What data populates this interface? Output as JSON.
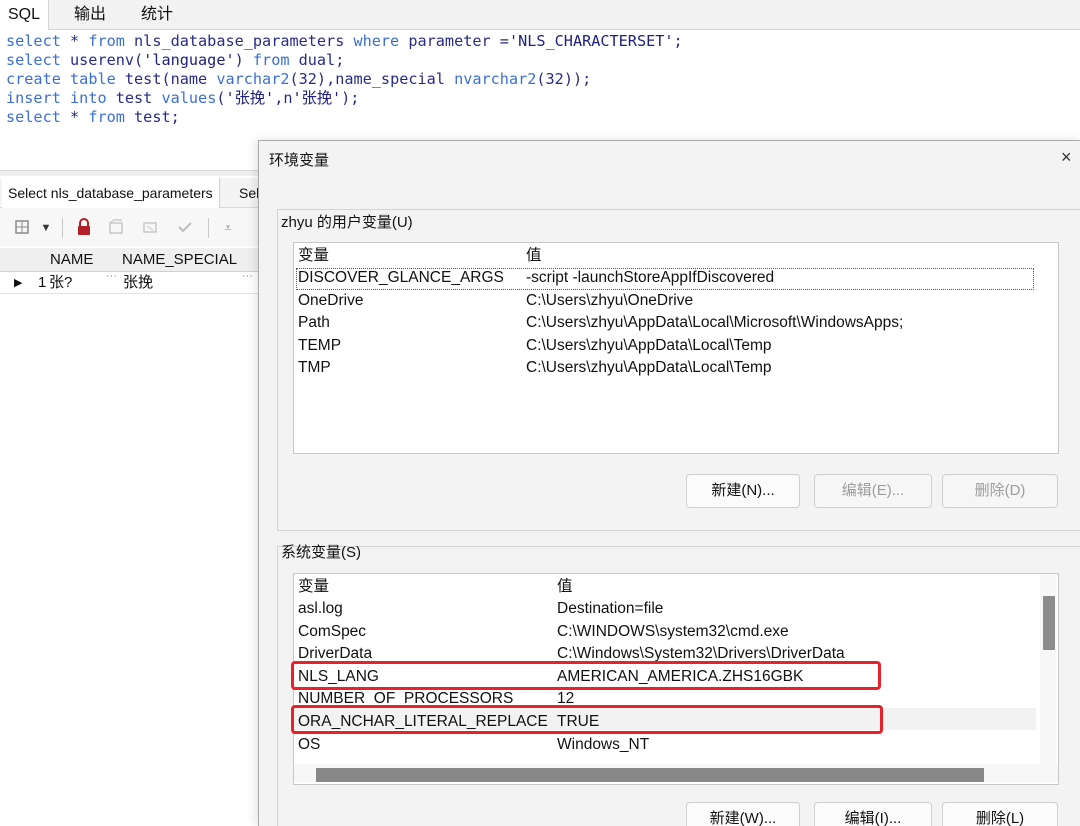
{
  "editor": {
    "tabs": [
      "SQL",
      "输出",
      "统计"
    ],
    "lines": [
      [
        {
          "t": "select",
          "c": "kw"
        },
        {
          "t": " * ",
          "c": "plain"
        },
        {
          "t": "from",
          "c": "kw"
        },
        {
          "t": " nls_database_parameters ",
          "c": "plain"
        },
        {
          "t": "where",
          "c": "kw"
        },
        {
          "t": " parameter =",
          "c": "plain"
        },
        {
          "t": "'NLS_CHARACTERSET'",
          "c": "str"
        },
        {
          "t": ";",
          "c": "plain"
        }
      ],
      [
        {
          "t": "select",
          "c": "kw"
        },
        {
          "t": " userenv(",
          "c": "plain"
        },
        {
          "t": "'language'",
          "c": "str"
        },
        {
          "t": ") ",
          "c": "plain"
        },
        {
          "t": "from",
          "c": "kw"
        },
        {
          "t": " dual;",
          "c": "plain"
        }
      ],
      [
        {
          "t": "create",
          "c": "kw"
        },
        {
          "t": " ",
          "c": "plain"
        },
        {
          "t": "table",
          "c": "kw"
        },
        {
          "t": " test(name ",
          "c": "plain"
        },
        {
          "t": "varchar2",
          "c": "kw"
        },
        {
          "t": "(32),name_special ",
          "c": "plain"
        },
        {
          "t": "nvarchar2",
          "c": "kw"
        },
        {
          "t": "(32));",
          "c": "plain"
        }
      ],
      [
        {
          "t": "insert",
          "c": "kw"
        },
        {
          "t": " ",
          "c": "plain"
        },
        {
          "t": "into",
          "c": "kw"
        },
        {
          "t": " test ",
          "c": "plain"
        },
        {
          "t": "values",
          "c": "kw"
        },
        {
          "t": "(",
          "c": "plain"
        },
        {
          "t": "'张挽'",
          "c": "str"
        },
        {
          "t": ",n",
          "c": "plain"
        },
        {
          "t": "'张挽'",
          "c": "str"
        },
        {
          "t": ");",
          "c": "plain"
        }
      ],
      [
        {
          "t": "select",
          "c": "kw"
        },
        {
          "t": " * ",
          "c": "plain"
        },
        {
          "t": "from",
          "c": "kw"
        },
        {
          "t": " test;",
          "c": "plain"
        }
      ]
    ]
  },
  "results": {
    "tabs": [
      "Select nls_database_parameters",
      "Sel"
    ],
    "toolbar_icons": [
      "query-grid-icon",
      "dropdown-arrow-icon",
      "lock-icon",
      "insert-record-icon",
      "delete-record-icon",
      "post-record-icon",
      "filter-icon"
    ],
    "columns": [
      "NAME",
      "NAME_SPECIAL"
    ],
    "row": {
      "num": "1",
      "name": "张?",
      "name_special": "张挽",
      "ellipsis": "···"
    }
  },
  "dialog": {
    "title": "环境变量",
    "close_glyph": "×",
    "user_group_label": "zhyu 的用户变量(U)",
    "user_headers": [
      "变量",
      "值"
    ],
    "user_vars": [
      [
        "DISCOVER_GLANCE_ARGS",
        "-script -launchStoreAppIfDiscovered"
      ],
      [
        "OneDrive",
        "C:\\Users\\zhyu\\OneDrive"
      ],
      [
        "Path",
        "C:\\Users\\zhyu\\AppData\\Local\\Microsoft\\WindowsApps;"
      ],
      [
        "TEMP",
        "C:\\Users\\zhyu\\AppData\\Local\\Temp"
      ],
      [
        "TMP",
        "C:\\Users\\zhyu\\AppData\\Local\\Temp"
      ]
    ],
    "user_buttons": {
      "new": "新建(N)...",
      "edit": "编辑(E)...",
      "delete": "删除(D)"
    },
    "sys_group_label": "系统变量(S)",
    "sys_headers": [
      "变量",
      "值"
    ],
    "sys_vars": [
      [
        "asl.log",
        "Destination=file"
      ],
      [
        "ComSpec",
        "C:\\WINDOWS\\system32\\cmd.exe"
      ],
      [
        "DriverData",
        "C:\\Windows\\System32\\Drivers\\DriverData"
      ],
      [
        "NLS_LANG",
        "AMERICAN_AMERICA.ZHS16GBK"
      ],
      [
        "NUMBER_OF_PROCESSORS",
        "12"
      ],
      [
        "ORA_NCHAR_LITERAL_REPLACE",
        "TRUE"
      ],
      [
        "OS",
        "Windows_NT"
      ]
    ],
    "sys_buttons": {
      "new": "新建(W)...",
      "edit": "编辑(I)...",
      "delete": "删除(L)"
    },
    "highlight_color": "#e8212b"
  }
}
